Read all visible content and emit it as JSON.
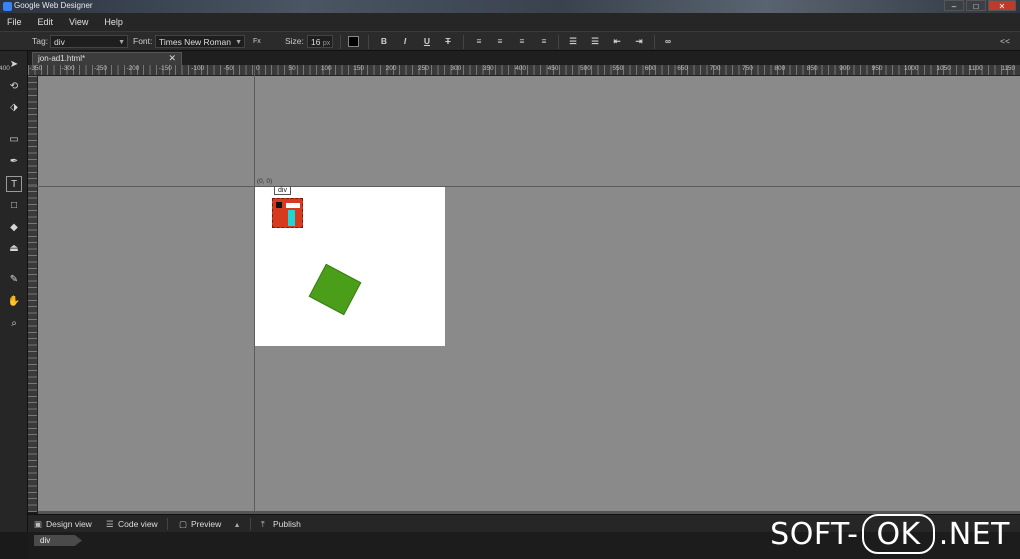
{
  "window": {
    "title": "Google Web Designer",
    "controls": {
      "minimize": "–",
      "maximize": "□",
      "close": "✕"
    }
  },
  "menu": [
    "File",
    "Edit",
    "View",
    "Help"
  ],
  "toolbar": {
    "tag_label": "Tag:",
    "tag_value": "div",
    "font_label": "Font:",
    "font_value": "Times New Roman",
    "fx_label": "Fx",
    "size_label": "Size:",
    "size_value": "16",
    "size_unit": "px",
    "text_color": "#000000",
    "collapse": "<<"
  },
  "tools": [
    "selection-tool",
    "3d-rotation-tool",
    "3d-translation-tool",
    "tag-tool",
    "pen-tool",
    "text-tool",
    "shape-tool",
    "fill-tool",
    "stroke-tool",
    "paint-bucket-tool",
    "hand-tool",
    "zoom-tool"
  ],
  "document": {
    "tab_name": "jon-ad1.html*",
    "tab_close": "✕"
  },
  "ruler": {
    "labels": [
      "-400",
      "-350",
      "-300",
      "-250",
      "-200",
      "-150",
      "-100",
      "-50",
      "0",
      "50",
      "100",
      "150",
      "200",
      "250",
      "300",
      "350",
      "400",
      "450",
      "500",
      "550",
      "600",
      "650",
      "700",
      "750",
      "800",
      "850",
      "900",
      "950",
      "1000",
      "1050",
      "1100",
      "1150"
    ]
  },
  "stage": {
    "origin_label": "(0, 0)",
    "selected_tag": "div",
    "background": "#ffffff"
  },
  "shapes": {
    "red_icon_color": "#d63b1f",
    "green_square_color": "#4a9e1a"
  },
  "view_bar": {
    "design_view": "Design view",
    "code_view": "Code view",
    "preview": "Preview",
    "publish": "Publish"
  },
  "status": {
    "breadcrumb": "div"
  },
  "watermark": {
    "left": "SOFT-",
    "middle": "OK",
    "right": ".NET"
  }
}
